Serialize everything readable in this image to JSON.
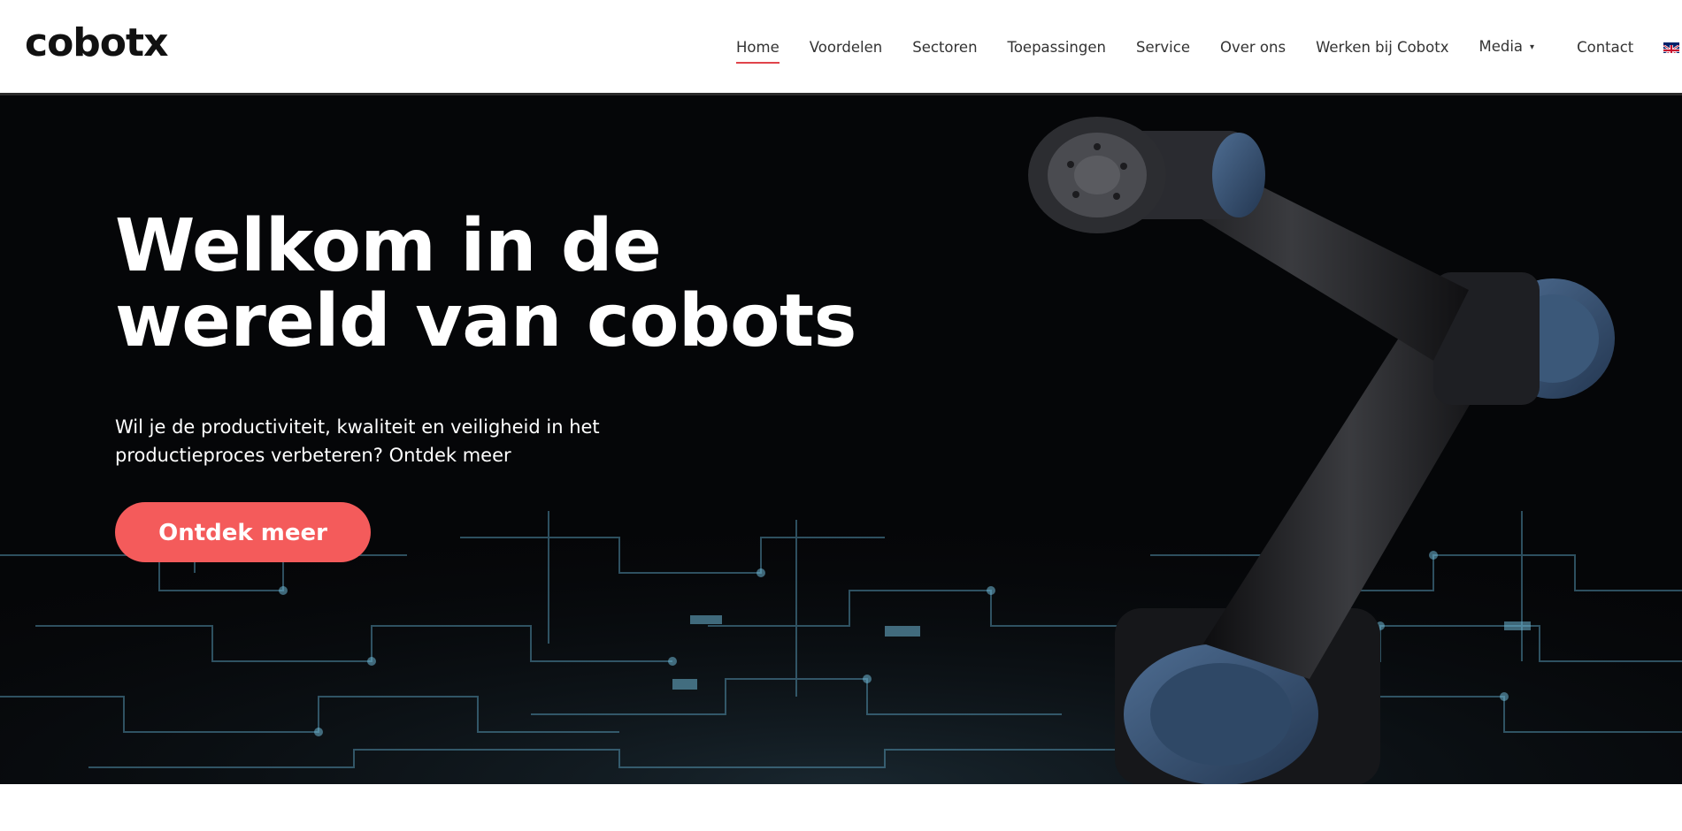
{
  "brand": {
    "logo_text": "cobot",
    "logo_x": "x"
  },
  "nav": {
    "items": [
      {
        "label": "Home",
        "active": true
      },
      {
        "label": "Voordelen"
      },
      {
        "label": "Sectoren"
      },
      {
        "label": "Toepassingen"
      },
      {
        "label": "Service"
      },
      {
        "label": "Over ons"
      },
      {
        "label": "Werken bij Cobotx"
      },
      {
        "label": "Media",
        "has_dropdown": true
      },
      {
        "label": "Contact"
      }
    ],
    "dropdown_caret": "▾",
    "language_flag": "uk-flag-icon"
  },
  "hero": {
    "title_line1": "Welkom in de",
    "title_line2": "wereld van cobots",
    "subtitle": "Wil je de productiviteit, kwaliteit en veiligheid in het productieproces verbeteren? Ontdek meer",
    "cta_label": "Ontdek meer"
  },
  "colors": {
    "accent": "#f45b5b",
    "active_underline": "#e0444b",
    "hero_bg": "#050608",
    "circuit": "#5fa8c8",
    "robot_joint": "#3d5878"
  }
}
